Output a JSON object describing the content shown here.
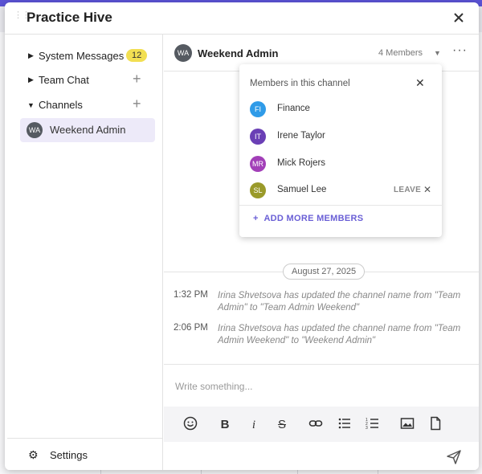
{
  "app": {
    "title": "Practice Hive"
  },
  "sidebar": {
    "items": [
      {
        "label": "System Messages",
        "badge": "12"
      },
      {
        "label": "Team Chat"
      },
      {
        "label": "Channels"
      }
    ],
    "channels": [
      {
        "initials": "WA",
        "label": "Weekend Admin"
      }
    ],
    "settings_label": "Settings"
  },
  "channel": {
    "initials": "WA",
    "title": "Weekend Admin",
    "members_label": "4 Members",
    "date": "August 27, 2025",
    "messages": [
      {
        "time": "1:32 PM",
        "text": "Irina Shvetsova has updated the channel name from \"Team Admin\" to \"Team Admin Weekend\""
      },
      {
        "time": "2:06 PM",
        "text": "Irina Shvetsova has updated the channel name from \"Team Admin Weekend\" to \"Weekend Admin\""
      }
    ]
  },
  "compose": {
    "placeholder": "Write something..."
  },
  "members_popup": {
    "title": "Members in this channel",
    "members": [
      {
        "initials": "FI",
        "name": "Finance",
        "color": "#2f9be8"
      },
      {
        "initials": "IT",
        "name": "Irene Taylor",
        "color": "#6a3fb5"
      },
      {
        "initials": "MR",
        "name": "Mick Rojers",
        "color": "#a23fb8"
      },
      {
        "initials": "SL",
        "name": "Samuel Lee",
        "color": "#9a9a2a"
      }
    ],
    "leave_label": "LEAVE",
    "add_label": "ADD MORE MEMBERS"
  },
  "colors": {
    "accent": "#6a5fd6",
    "badge": "#f2df52",
    "selected": "#edeaf9"
  }
}
